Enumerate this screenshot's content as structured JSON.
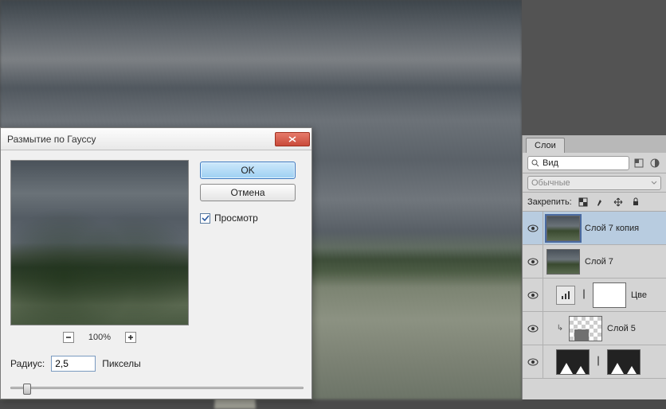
{
  "dialog": {
    "title": "Размытие по Гауссу",
    "ok_label": "OK",
    "cancel_label": "Отмена",
    "preview_label": "Просмотр",
    "zoom_level": "100%",
    "radius_label": "Радиус:",
    "radius_value": "2,5",
    "radius_unit": "Пикселы"
  },
  "layers_panel": {
    "tab_label": "Слои",
    "kind_label": "Вид",
    "blend_mode": "Обычные",
    "lock_label": "Закрепить:",
    "truncated_label": "Цве",
    "layers": [
      {
        "name": "Слой 7 копия"
      },
      {
        "name": "Слой 7"
      },
      {
        "name": ""
      },
      {
        "name": "Слой 5"
      },
      {
        "name": ""
      }
    ]
  }
}
